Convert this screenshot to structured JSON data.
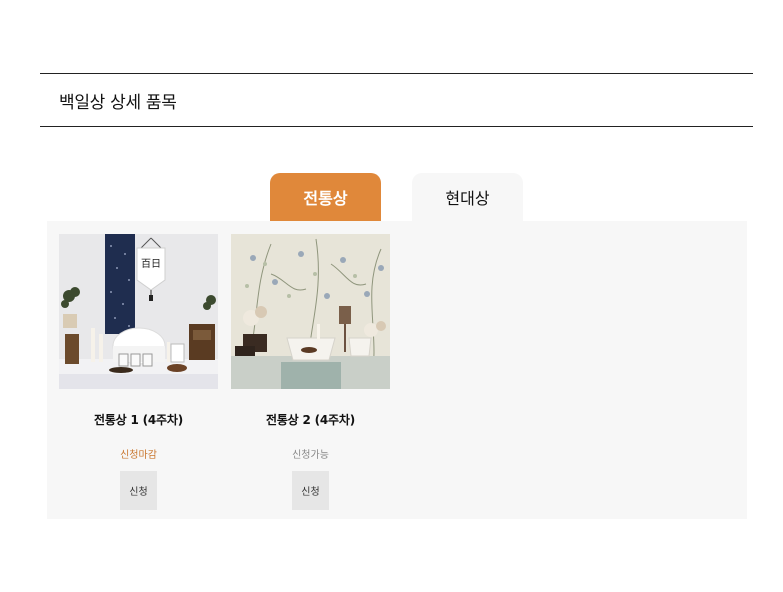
{
  "section": {
    "title": "백일상 상세 품목"
  },
  "tabs": [
    {
      "label": "전통상",
      "active": true
    },
    {
      "label": "현대상",
      "active": false
    }
  ],
  "items": [
    {
      "name": "전통상 1 (4주차)",
      "status": "신청마감",
      "button": "신청",
      "image_text": "百日"
    },
    {
      "name": "전통상 2 (4주차)",
      "status": "신청가능",
      "button": "신청"
    }
  ],
  "colors": {
    "accent": "#e0883a",
    "panel_bg": "#f7f7f7",
    "status_closed": "#c9772f",
    "status_open": "#888888"
  }
}
